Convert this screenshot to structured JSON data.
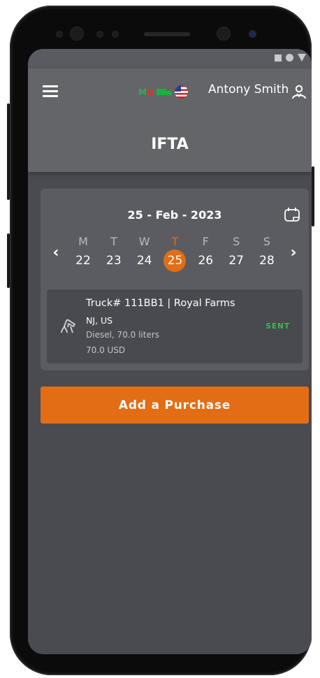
{
  "header": {
    "badge_m": "M",
    "badge_d": "D",
    "username": "Antony Smith",
    "title": "IFTA"
  },
  "calendar": {
    "date_title": "25 - Feb - 2023",
    "days": [
      {
        "letter": "M",
        "num": "22"
      },
      {
        "letter": "T",
        "num": "23"
      },
      {
        "letter": "W",
        "num": "24"
      },
      {
        "letter": "T",
        "num": "25"
      },
      {
        "letter": "F",
        "num": "26"
      },
      {
        "letter": "S",
        "num": "27"
      },
      {
        "letter": "S",
        "num": "28"
      }
    ],
    "selected_day": "25",
    "prev_icon": "chevron-left-icon",
    "next_icon": "chevron-right-icon"
  },
  "entry": {
    "title": "Truck# 111BB1 | Royal Farms",
    "location": "NJ, US",
    "fuel": "Diesel, 70.0 liters",
    "amount": "70.0 USD",
    "status": "SENT",
    "icon": "fuel-nozzle-icon"
  },
  "actions": {
    "add_label": "Add a Purchase"
  },
  "colors": {
    "accent": "#e26d14",
    "status_sent": "#2fbf53",
    "background": "#4a4b50",
    "card": "#5b5c61",
    "entry": "#494a4f",
    "header": "#646569"
  }
}
